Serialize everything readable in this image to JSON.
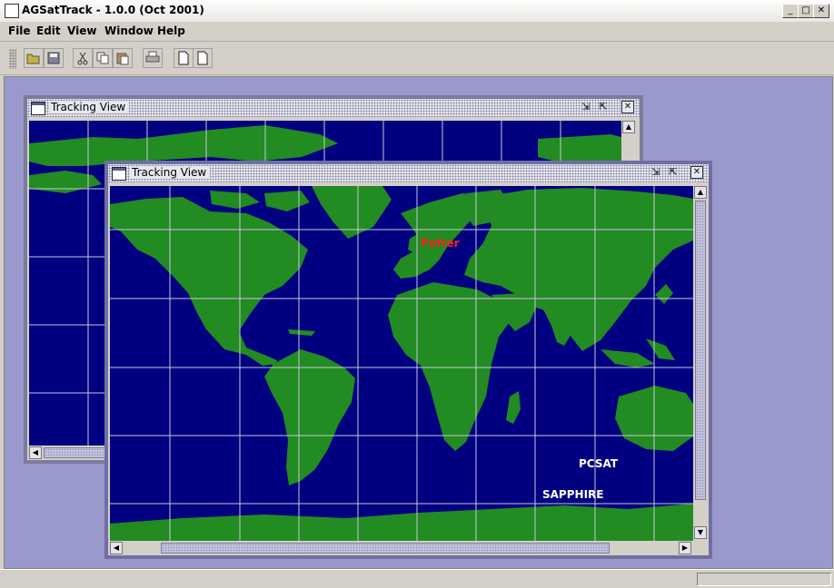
{
  "app": {
    "title": "AGSatTrack - 1.0.0 (Oct 2001)"
  },
  "menu": {
    "file": "File",
    "edit": "Edit",
    "view": "View",
    "window": "Window",
    "help": "Help"
  },
  "toolbar": {
    "buttons": [
      "open-icon",
      "save-icon",
      "cut-icon",
      "copy-icon",
      "paste-icon",
      "print-icon",
      "new-document-icon",
      "new-window-icon"
    ]
  },
  "windows": {
    "back": {
      "title": "Tracking View"
    },
    "front": {
      "title": "Tracking View",
      "labels": {
        "ground_station": "Potter",
        "sat1": "PCSAT",
        "sat2": "SAPPHIRE"
      }
    }
  },
  "colors": {
    "ocean": "#000080",
    "land": "#228b22",
    "grid": "#c8c8d8",
    "station": "#ff2020",
    "satellite": "#ffffff",
    "desktop": "#9999cc"
  }
}
